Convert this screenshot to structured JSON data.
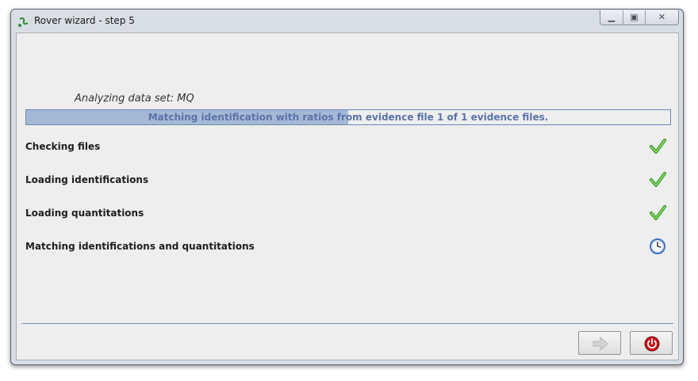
{
  "window": {
    "title": "Rover wizard - step 5",
    "controls": [
      "minimize-icon",
      "maximize-icon",
      "close-icon"
    ]
  },
  "main": {
    "analyzing_label": "Analyzing data set: MQ",
    "progress": {
      "text": "Matching identification with ratios from evidence file 1 of 1 evidence files.",
      "fraction": 0.5
    },
    "steps": [
      {
        "label": "Checking files",
        "status": "done",
        "icon": "check-icon"
      },
      {
        "label": "Loading identifications",
        "status": "done",
        "icon": "check-icon"
      },
      {
        "label": "Loading quantitations",
        "status": "done",
        "icon": "check-icon"
      },
      {
        "label": "Matching identifications and quantitations",
        "status": "in-progress",
        "icon": "clock-icon"
      }
    ]
  },
  "footer": {
    "next_button": {
      "icon": "arrow-right-icon",
      "enabled": false
    },
    "exit_button": {
      "icon": "power-icon",
      "enabled": true
    }
  },
  "colors": {
    "check": "#3fae2a",
    "progress_fill": "#a3b9d6",
    "progress_text": "#5a74a8",
    "exit": "#c8141c"
  }
}
